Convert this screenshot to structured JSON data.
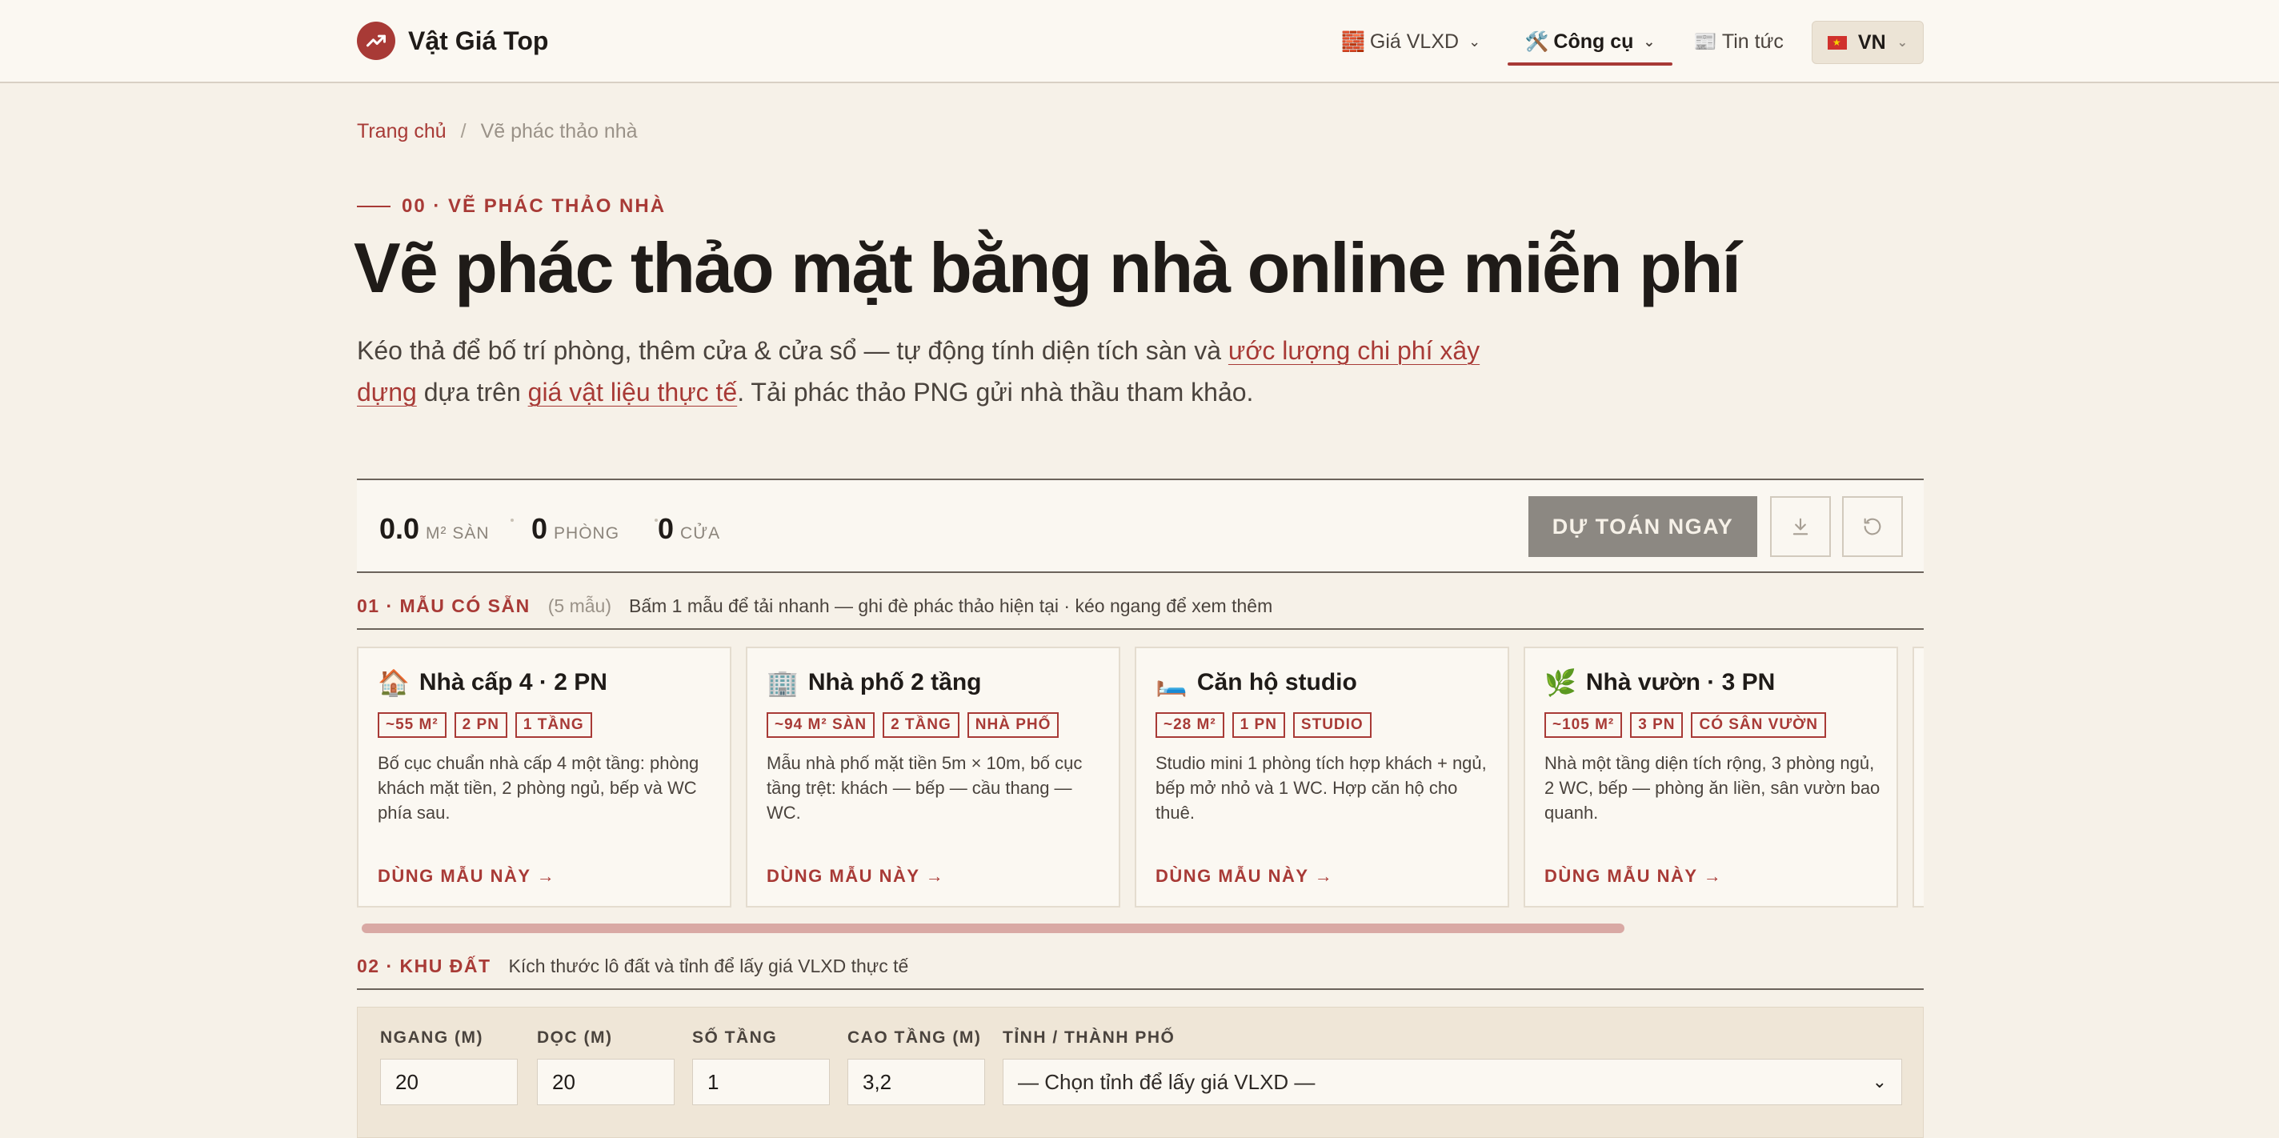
{
  "header": {
    "brand": "Vật Giá Top",
    "nav": [
      {
        "icon": "brick-icon",
        "emoji": "🧱",
        "label": "Giá VLXD",
        "has_dropdown": true
      },
      {
        "icon": "tools-icon",
        "emoji": "🛠️",
        "label": "Công cụ",
        "has_dropdown": true,
        "active": true
      },
      {
        "icon": "newspaper-icon",
        "emoji": "📰",
        "label": "Tin tức",
        "has_dropdown": false
      }
    ],
    "language": "VN"
  },
  "breadcrumb": {
    "home": "Trang chủ",
    "separator": "/",
    "current": "Vẽ phác thảo nhà"
  },
  "hero": {
    "eyebrow": "00 · VẼ PHÁC THẢO NHÀ",
    "title": "Vẽ phác thảo mặt bằng nhà online miễn phí",
    "desc_part1": "Kéo thả để bố trí phòng, thêm cửa & cửa sổ — tự động tính diện tích sàn và ",
    "desc_link1": "ước lượng chi phí xây dựng",
    "desc_part2": " dựa trên ",
    "desc_link2": "giá vật liệu thực tế",
    "desc_part3": ". Tải phác thảo PNG gửi nhà thầu tham khảo."
  },
  "stats": {
    "area_value": "0.0",
    "area_unit": "M² SÀN",
    "rooms_value": "0",
    "rooms_unit": "PHÒNG",
    "doors_value": "0",
    "doors_unit": "CỬA",
    "estimate_button": "DỰ TOÁN NGAY"
  },
  "templates_section": {
    "label": "01 · MẪU CÓ SẴN",
    "count": "(5 mẫu)",
    "hint": "Bấm 1 mẫu để tải nhanh — ghi đè phác thảo hiện tại · kéo ngang để xem thêm",
    "use_label": "DÙNG MẪU NÀY →",
    "cards": [
      {
        "emoji": "🏠",
        "icon": "house-icon",
        "title": "Nhà cấp 4 · 2 PN",
        "tags": [
          "~55 M²",
          "2 PN",
          "1 TẦNG"
        ],
        "desc": "Bố cục chuẩn nhà cấp 4 một tầng: phòng khách mặt tiền, 2 phòng ngủ, bếp và WC phía sau."
      },
      {
        "emoji": "🏢",
        "icon": "building-icon",
        "title": "Nhà phố 2 tầng",
        "tags": [
          "~94 M² SÀN",
          "2 TẦNG",
          "NHÀ PHỐ"
        ],
        "desc": "Mẫu nhà phố mặt tiền 5m × 10m, bố cục tầng trệt: khách — bếp — cầu thang — WC."
      },
      {
        "emoji": "🛏️",
        "icon": "bed-icon",
        "title": "Căn hộ studio",
        "tags": [
          "~28 M²",
          "1 PN",
          "STUDIO"
        ],
        "desc": "Studio mini 1 phòng tích hợp khách + ngủ, bếp mở nhỏ và 1 WC. Hợp căn hộ cho thuê."
      },
      {
        "emoji": "🌿",
        "icon": "leaf-icon",
        "title": "Nhà vườn · 3 PN",
        "tags": [
          "~105 M²",
          "3 PN",
          "CÓ SÂN VƯỜN"
        ],
        "desc": "Nhà một tầng diện tích rộng, 3 phòng ngủ, 2 WC, bếp — phòng ăn liền, sân vườn bao quanh."
      }
    ]
  },
  "land_section": {
    "label": "02 · KHU ĐẤT",
    "hint": "Kích thước lô đất và tỉnh để lấy giá VLXD thực tế",
    "fields": {
      "width_label": "NGANG (M)",
      "width_value": "20",
      "length_label": "DỌC (M)",
      "length_value": "20",
      "floors_label": "SỐ TẦNG",
      "floors_value": "1",
      "height_label": "CAO TẦNG (M)",
      "height_value": "3,2",
      "province_label": "TỈNH / THÀNH PHỐ",
      "province_value": "— Chọn tỉnh để lấy giá VLXD —"
    }
  },
  "colors": {
    "accent": "#a83a36",
    "background": "#f6f1e8",
    "button_disabled": "#8c8882"
  }
}
